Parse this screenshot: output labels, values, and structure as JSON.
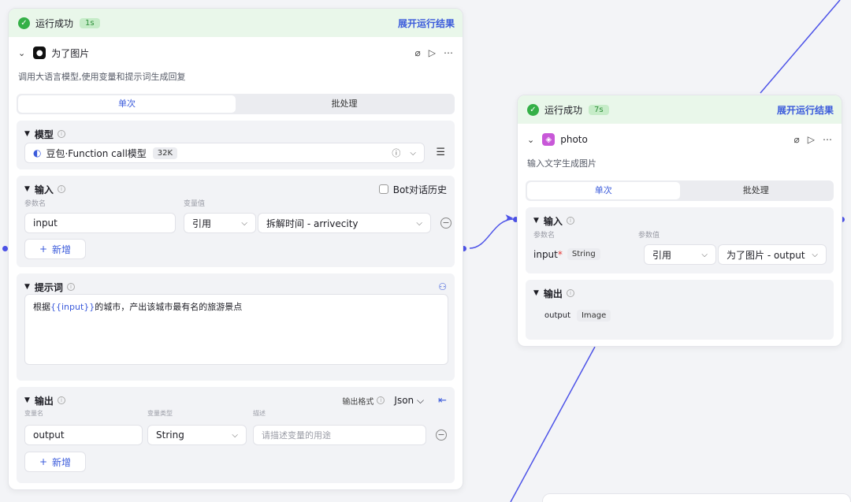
{
  "colors": {
    "accent": "#3b5bdb",
    "success": "#34b047",
    "wire": "#4d53e8",
    "run_bg": "#e9f7ea"
  },
  "node1": {
    "status": "运行成功",
    "time": "1s",
    "expand": "展开运行结果",
    "title": "为了图片",
    "icon": "chatbot-icon",
    "description": "调用大语言模型,使用变量和提示词生成回复",
    "tabs": [
      "单次",
      "批处理"
    ],
    "model": {
      "label": "模型",
      "name": "豆包·Function call模型",
      "context": "32K"
    },
    "input": {
      "label": "输入",
      "history": "Bot对话历史",
      "col_name": "参数名",
      "col_value": "变量值",
      "param": "input",
      "ref": "引用",
      "value": "拆解时间 - arrivecity",
      "add": "新增"
    },
    "prompt": {
      "label": "提示词",
      "text_before": "根据",
      "var": "{{input}}",
      "text_after": "的城市，产出该城市最有名的旅游景点"
    },
    "output": {
      "label": "输出",
      "format_label": "输出格式",
      "format": "Json",
      "col_name": "变量名",
      "col_type": "变量类型",
      "col_desc": "描述",
      "name": "output",
      "type": "String",
      "desc_placeholder": "请描述变量的用途",
      "add": "新增"
    }
  },
  "node2": {
    "status": "运行成功",
    "time": "7s",
    "expand": "展开运行结果",
    "title": "photo",
    "icon": "image-gen-icon",
    "description": "输入文字生成图片",
    "tabs": [
      "单次",
      "批处理"
    ],
    "input": {
      "label": "输入",
      "col_name": "参数名",
      "col_value": "参数值",
      "param": "input",
      "required": "*",
      "type": "String",
      "ref": "引用",
      "value": "为了图片 - output"
    },
    "output": {
      "label": "输出",
      "name": "output",
      "type": "Image"
    }
  }
}
